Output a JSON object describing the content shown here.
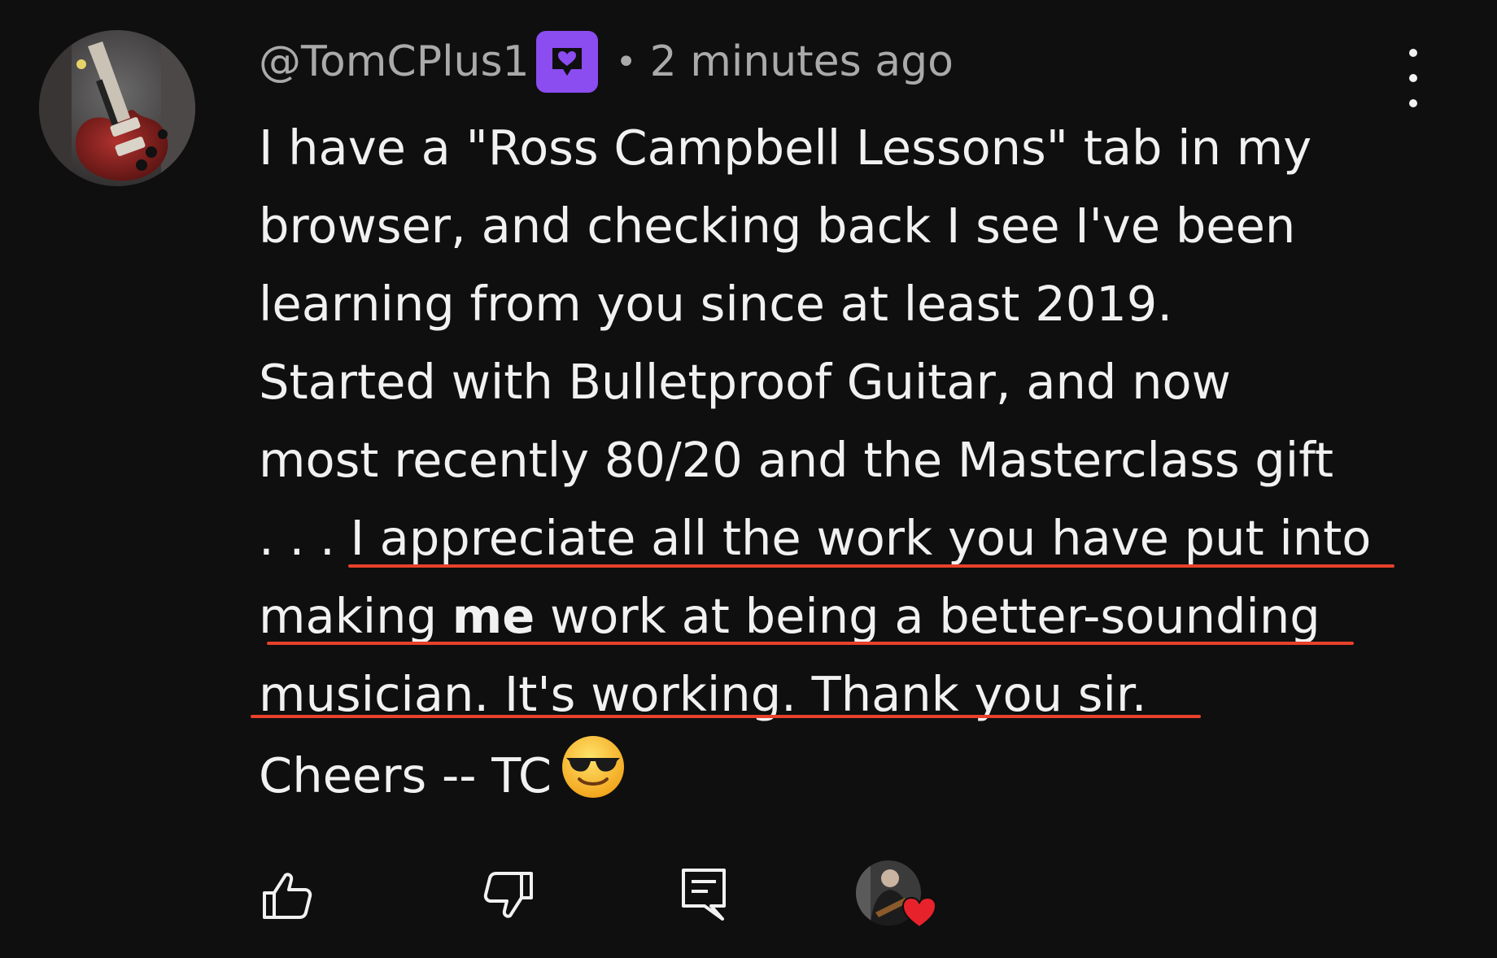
{
  "comment": {
    "author": "@TomCPlus1",
    "separator": "•",
    "timestamp": "2 minutes ago",
    "lines": [
      "I have a \"Ross Campbell Lessons\" tab in my",
      "browser, and checking back I see I've been",
      "learning from you since at least 2019.",
      "Started with Bulletproof Guitar, and now",
      "most recently 80/20 and the Masterclass gift"
    ],
    "line6_prefix": ". . . ",
    "line6_text": "I appreciate all the work you have put into",
    "line7_before": "making ",
    "line7_bold": "me",
    "line7_after": " work at being a better-sounding",
    "line8": "musician.  It's working.  Thank you sir.",
    "line9": "Cheers -- TC",
    "emoji": "smiling-face-with-sunglasses"
  },
  "badge_icon": "heart-speech-bubble-icon",
  "actions": {
    "like_icon": "thumbs-up-icon",
    "dislike_icon": "thumbs-down-icon",
    "reply_icon": "reply-comment-icon",
    "creator_heart_icon": "creator-heart-icon"
  },
  "colors": {
    "background": "#0f0f0f",
    "text": "#f1f1f1",
    "secondary_text": "#aaaaaa",
    "badge": "#8b4cf0",
    "underline": "#e8412c",
    "heart": "#e8222b"
  }
}
